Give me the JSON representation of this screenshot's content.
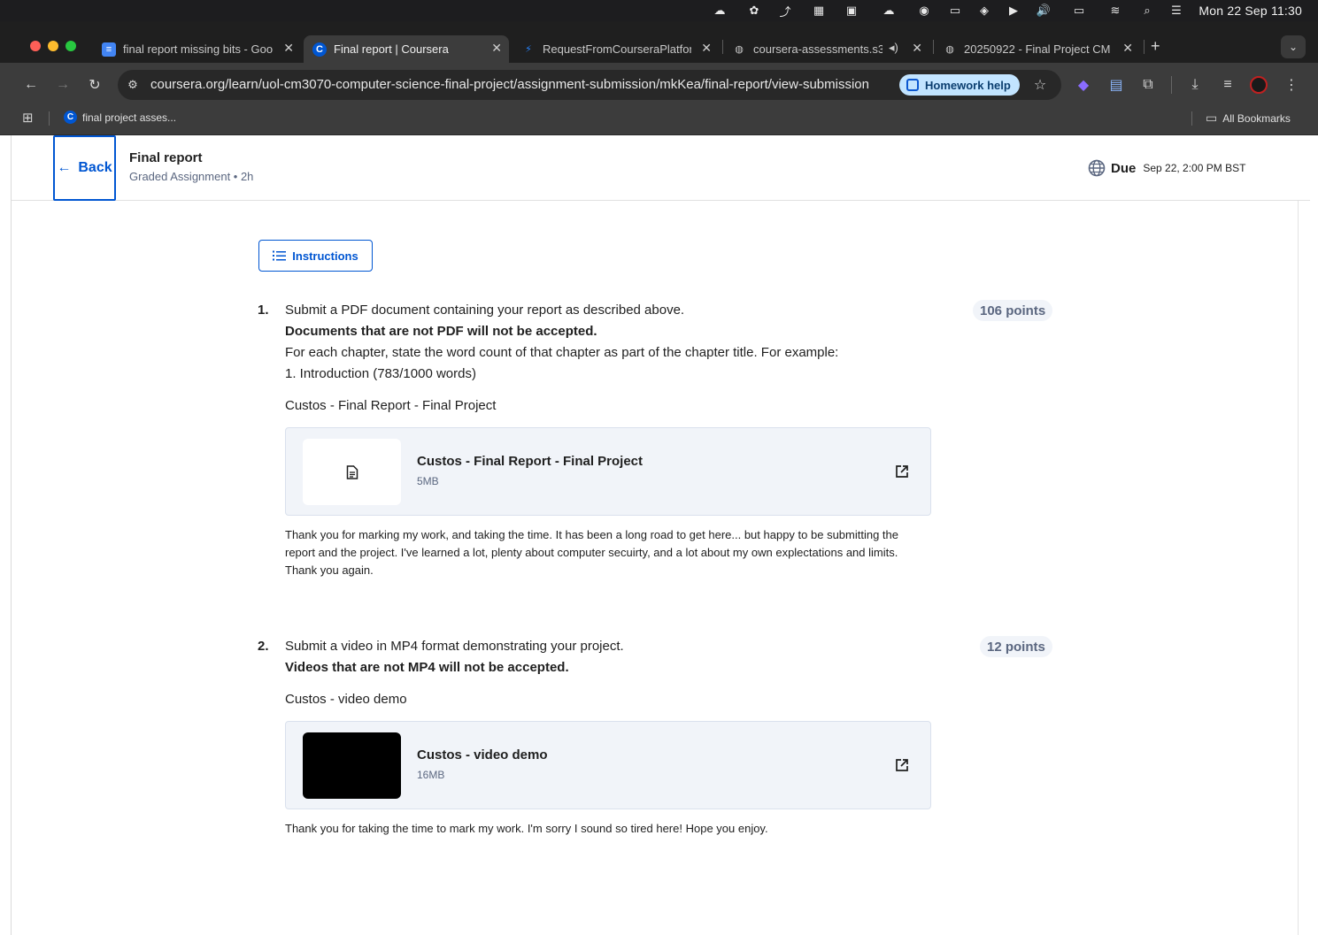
{
  "system": {
    "clock": "Mon 22 Sep  11:30"
  },
  "tabs": [
    {
      "title": "final report missing bits - Goo",
      "favicon": "docs-icon"
    },
    {
      "title": "Final report | Coursera",
      "favicon": "coursera-icon"
    },
    {
      "title": "RequestFromCourseraPlatfor",
      "favicon": "jira-icon"
    },
    {
      "title": "coursera-assessments.s3",
      "favicon": "globe-icon"
    },
    {
      "title": "20250922 - Final Project CM",
      "favicon": "globe-icon"
    }
  ],
  "toolbar": {
    "url": "coursera.org/learn/uol-cm3070-computer-science-final-project/assignment-submission/mkKea/final-report/view-submission",
    "homework_help": "Homework help"
  },
  "bookmarks": {
    "items": [
      {
        "label": "final project asses..."
      }
    ],
    "all_bookmarks": "All Bookmarks"
  },
  "header": {
    "back_label": "Back",
    "title": "Final report",
    "subtitle": "Graded Assignment • 2h",
    "due_label": "Due",
    "due_date": "Sep 22, 2:00 PM BST"
  },
  "instructions_label": "Instructions",
  "questions": [
    {
      "number": "1.",
      "points": "106 points",
      "lines": [
        "Submit a PDF document containing your report as described above.",
        "Documents that are not PDF will not be accepted.",
        "For each chapter, state the word count of that chapter as part of the chapter title.  For example:",
        "1. Introduction (783/1000 words)"
      ],
      "submission_title": "Custos - Final Report - Final Project",
      "file": {
        "name": "Custos - Final Report - Final Project",
        "size": "5MB"
      },
      "comment": "Thank you for marking my work, and taking the time. It has been a long road to get here... but happy to be submitting the report and the project. I've learned a lot, plenty about computer secuirty, and a lot about my own explectations and limits. Thank you again."
    },
    {
      "number": "2.",
      "points": "12 points",
      "lines": [
        "Submit a video in MP4 format demonstrating your project.",
        "Videos that are not MP4 will not be accepted."
      ],
      "submission_title": "Custos - video demo",
      "file": {
        "name": "Custos - video demo",
        "size": "16MB"
      },
      "comment": "Thank you for taking the time to mark my work. I'm sorry I sound so tired here! Hope you enjoy."
    }
  ]
}
